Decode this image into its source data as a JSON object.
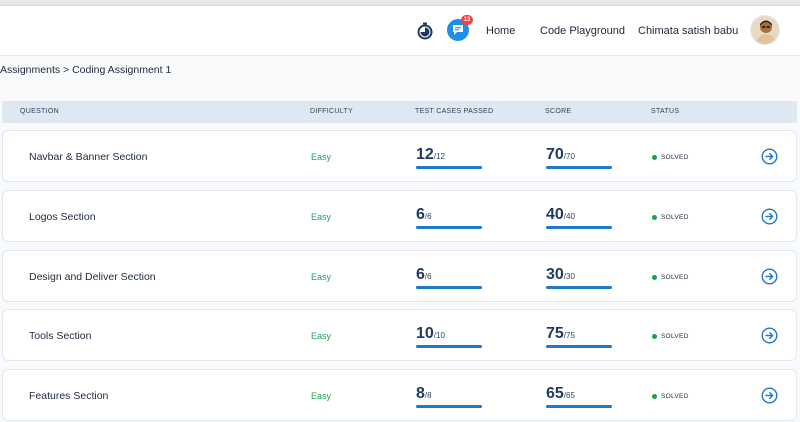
{
  "header": {
    "chat_badge_count": "13",
    "nav_home": "Home",
    "nav_playground": "Code Playground",
    "user_name": "Chimata satish babu"
  },
  "breadcrumb": "Assignments > Coding Assignment 1",
  "table": {
    "columns": [
      "QUESTION",
      "DIFFICULTY",
      "TEST CASES PASSED",
      "SCORE",
      "STATUS"
    ],
    "rows": [
      {
        "question": "Navbar & Banner Section",
        "difficulty": "Easy",
        "tests_passed": "12",
        "tests_total": "/12",
        "score": "70",
        "score_total": "/70",
        "status": "SOLVED",
        "tests_fraction": 1,
        "score_fraction": 1
      },
      {
        "question": "Logos Section",
        "difficulty": "Easy",
        "tests_passed": "6",
        "tests_total": "/6",
        "score": "40",
        "score_total": "/40",
        "status": "SOLVED",
        "tests_fraction": 1,
        "score_fraction": 1
      },
      {
        "question": "Design and Deliver Section",
        "difficulty": "Easy",
        "tests_passed": "6",
        "tests_total": "/6",
        "score": "30",
        "score_total": "/30",
        "status": "SOLVED",
        "tests_fraction": 1,
        "score_fraction": 1
      },
      {
        "question": "Tools Section",
        "difficulty": "Easy",
        "tests_passed": "10",
        "tests_total": "/10",
        "score": "75",
        "score_total": "/75",
        "status": "SOLVED",
        "tests_fraction": 1,
        "score_fraction": 1
      },
      {
        "question": "Features Section",
        "difficulty": "Easy",
        "tests_passed": "8",
        "tests_total": "/8",
        "score": "65",
        "score_total": "/65",
        "status": "SOLVED",
        "tests_fraction": 1,
        "score_fraction": 1
      }
    ]
  },
  "icons": {
    "timer": "stopwatch-icon",
    "chat": "chat-icon",
    "row_action": "arrow-circle-right-icon"
  },
  "colors": {
    "accent": "#1f78c9",
    "difficulty_easy": "#22a55b",
    "solved": "#16a34a",
    "badge": "#ef4444"
  }
}
